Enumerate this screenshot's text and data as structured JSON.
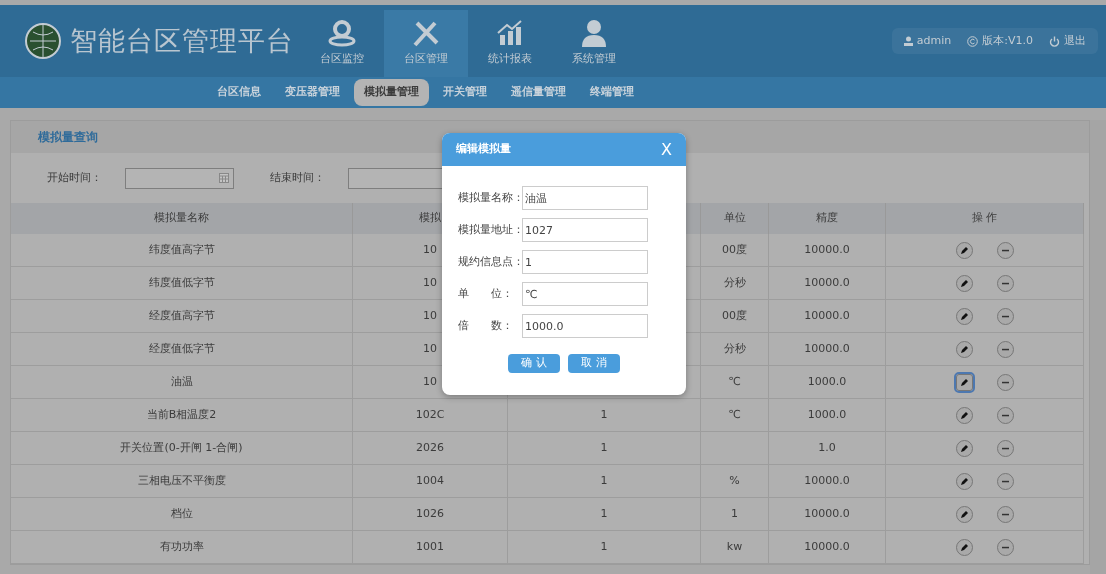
{
  "brand": {
    "title": "智能台区管理平台"
  },
  "main_nav": [
    {
      "label": "台区监控",
      "selected": false
    },
    {
      "label": "台区管理",
      "selected": true
    },
    {
      "label": "统计报表",
      "selected": false
    },
    {
      "label": "系统管理",
      "selected": false
    }
  ],
  "user_bar": {
    "user": "admin",
    "version": "版本:V1.0",
    "logout": "退出"
  },
  "sub_nav": [
    {
      "label": "台区信息",
      "selected": false
    },
    {
      "label": "变压器管理",
      "selected": false
    },
    {
      "label": "模拟量管理",
      "selected": true
    },
    {
      "label": "开关管理",
      "selected": false
    },
    {
      "label": "遥信量管理",
      "selected": false
    },
    {
      "label": "终端管理",
      "selected": false
    }
  ],
  "panel": {
    "title": "模拟量查询",
    "filters": [
      {
        "label": "开始时间：",
        "has_calendar": true
      },
      {
        "label": "结束时间：",
        "has_calendar": false
      }
    ]
  },
  "table": {
    "columns": {
      "name": "模拟量名称",
      "address": "模拟",
      "unit": "单位",
      "precision": "精度",
      "actions": "操 作"
    },
    "rows": [
      {
        "name": "纬度值高字节",
        "address": "10",
        "unit": "00度",
        "precision": "10000.0",
        "focused": false
      },
      {
        "name": "纬度值低字节",
        "address": "10",
        "unit": "分秒",
        "precision": "10000.0",
        "focused": false
      },
      {
        "name": "经度值高字节",
        "address": "10",
        "unit": "00度",
        "precision": "10000.0",
        "focused": false
      },
      {
        "name": "经度值低字节",
        "address": "10",
        "unit": "分秒",
        "precision": "10000.0",
        "focused": false
      },
      {
        "name": "油温",
        "address": "10",
        "unit": "℃",
        "precision": "1000.0",
        "focused": true
      },
      {
        "name": "当前B相温度2",
        "address": "102C",
        "column_3": "1",
        "unit": "℃",
        "precision": "1000.0",
        "focused": false
      },
      {
        "name": "开关位置(0-开闸 1-合闸)",
        "address": "2026",
        "column_3": "1",
        "precision": "1.0",
        "focused": false
      },
      {
        "name": "三相电压不平衡度",
        "address": "1004",
        "column_3": "1",
        "unit": "%",
        "precision": "10000.0",
        "focused": false
      },
      {
        "name": "档位",
        "address": "1026",
        "column_3": "1",
        "unit": "1",
        "precision": "10000.0",
        "focused": false
      },
      {
        "name": "有功功率",
        "address": "1001",
        "column_3": "1",
        "unit": "kw",
        "precision": "10000.0",
        "focused": false
      }
    ]
  },
  "dialog": {
    "title": "编辑模拟量",
    "close": "X",
    "fields": [
      {
        "label": "模拟量名称：",
        "value": "油温"
      },
      {
        "label": "模拟量地址：",
        "value": "1027"
      },
      {
        "label": "规约信息点：",
        "value": "1"
      },
      {
        "label": "单　　位：",
        "value": "℃"
      },
      {
        "label": "倍　　数：",
        "value": "1000.0"
      }
    ],
    "buttons": [
      "确 认",
      "取 消"
    ]
  }
}
